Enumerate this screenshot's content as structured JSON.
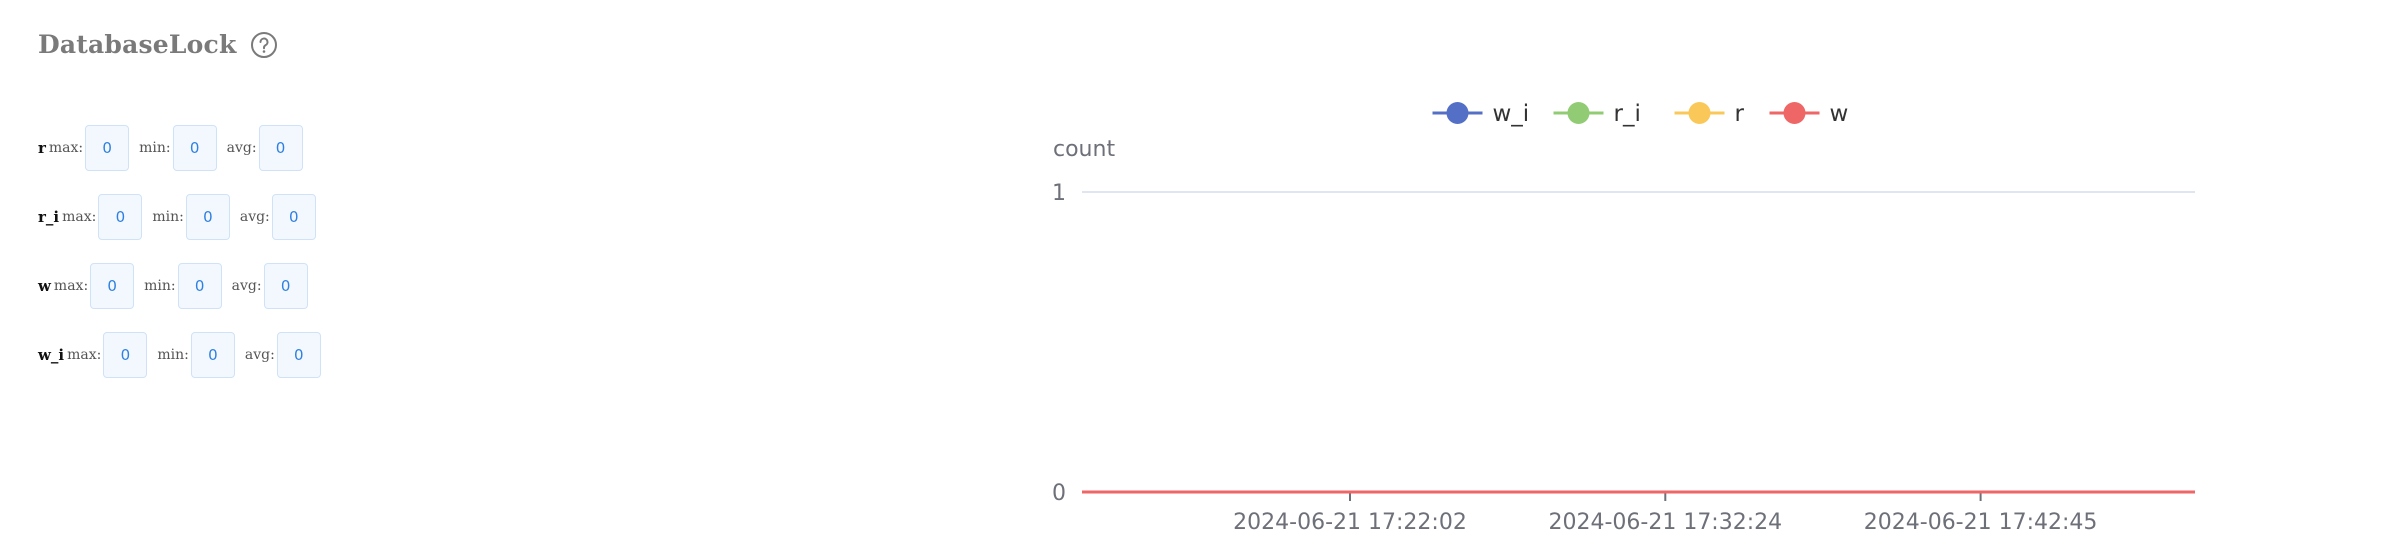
{
  "panel": {
    "title": "DatabaseLock",
    "help_icon": "question-circle-icon"
  },
  "stats": [
    {
      "name": "r",
      "max_label": "max:",
      "max": "0",
      "min_label": "min:",
      "min": "0",
      "avg_label": "avg:",
      "avg": "0"
    },
    {
      "name": "r_i",
      "max_label": "max:",
      "max": "0",
      "min_label": "min:",
      "min": "0",
      "avg_label": "avg:",
      "avg": "0"
    },
    {
      "name": "w",
      "max_label": "max:",
      "max": "0",
      "min_label": "min:",
      "min": "0",
      "avg_label": "avg:",
      "avg": "0"
    },
    {
      "name": "w_i",
      "max_label": "max:",
      "max": "0",
      "min_label": "min:",
      "min": "0",
      "avg_label": "avg:",
      "avg": "0"
    }
  ],
  "chart_data": {
    "type": "line",
    "title": "",
    "xlabel": "",
    "ylabel": "count",
    "ylim": [
      0,
      1
    ],
    "y_ticks": [
      "0",
      "1"
    ],
    "x_tick_labels": [
      "2024-06-21 17:22:02",
      "2024-06-21 17:32:24",
      "2024-06-21 17:42:45"
    ],
    "grid": true,
    "legend_placement": "top-center",
    "series": [
      {
        "name": "w_i",
        "color": "#5470c6",
        "values": [
          0,
          0
        ]
      },
      {
        "name": "r_i",
        "color": "#91cc75",
        "values": [
          0,
          0
        ]
      },
      {
        "name": "r",
        "color": "#fac858",
        "values": [
          0,
          0
        ]
      },
      {
        "name": "w",
        "color": "#ee6666",
        "values": [
          0,
          0
        ]
      }
    ]
  }
}
